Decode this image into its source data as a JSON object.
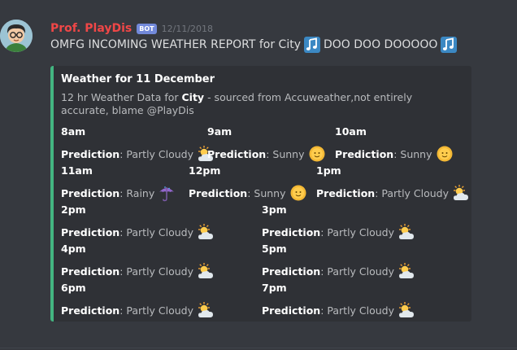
{
  "message": {
    "author": "Prof. PlayDis",
    "bot_tag": "BOT",
    "timestamp": "12/11/2018",
    "text_before": "OMFG INCOMING WEATHER REPORT for City",
    "text_middle": "DOO DOO DOOOOO"
  },
  "embed": {
    "title": "Weather for 11 December",
    "desc_prefix": "12 hr Weather Data for ",
    "desc_bold": "City",
    "desc_suffix": " - sourced from Accuweather,not entirely accurate, blame @PlayDis",
    "accent_color": "#43b581",
    "prediction_label": "Prediction",
    "fields": [
      {
        "name": "8am",
        "prediction": "Partly Cloudy",
        "icon": "partly-cloudy-icon"
      },
      {
        "name": "9am",
        "prediction": "Sunny",
        "icon": "sun-icon"
      },
      {
        "name": "10am",
        "prediction": "Sunny",
        "icon": "sun-icon"
      },
      {
        "name": "11am",
        "prediction": "Rainy",
        "icon": "umbrella-icon"
      },
      {
        "name": "12pm",
        "prediction": "Sunny",
        "icon": "sun-icon"
      },
      {
        "name": "1pm",
        "prediction": "Partly Cloudy",
        "icon": "partly-cloudy-icon"
      },
      {
        "name": "2pm",
        "prediction": "Partly Cloudy",
        "icon": "partly-cloudy-icon"
      },
      {
        "name": "3pm",
        "prediction": "Partly Cloudy",
        "icon": "partly-cloudy-icon"
      },
      {
        "name": "4pm",
        "prediction": "Partly Cloudy",
        "icon": "partly-cloudy-icon"
      },
      {
        "name": "5pm",
        "prediction": "Partly Cloudy",
        "icon": "partly-cloudy-icon"
      },
      {
        "name": "6pm",
        "prediction": "Partly Cloudy",
        "icon": "partly-cloudy-icon"
      },
      {
        "name": "7pm",
        "prediction": "Partly Cloudy",
        "icon": "partly-cloudy-icon"
      }
    ]
  }
}
